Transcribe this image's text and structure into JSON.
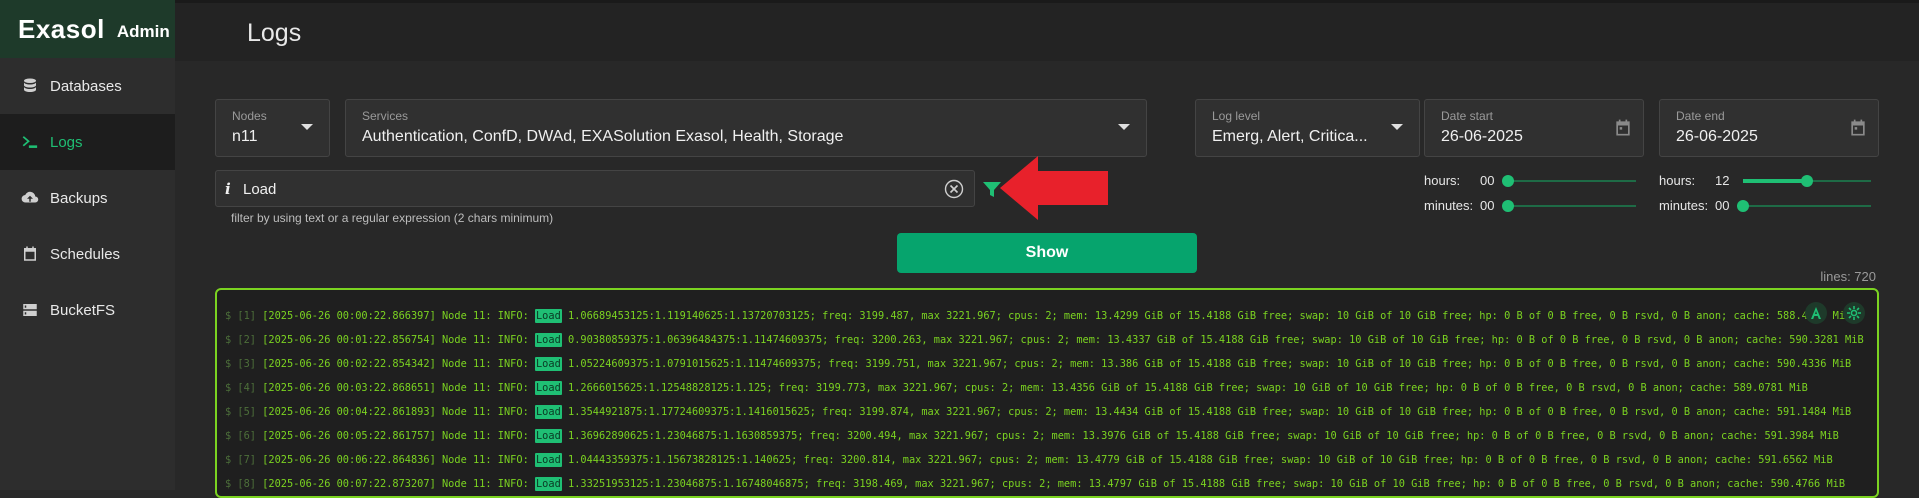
{
  "brand": {
    "logo": "Exasol",
    "sub": "Admin"
  },
  "nav": [
    {
      "label": "Databases",
      "icon": "database-icon"
    },
    {
      "label": "Logs",
      "icon": "terminal-icon"
    },
    {
      "label": "Backups",
      "icon": "cloud-upload-icon"
    },
    {
      "label": "Schedules",
      "icon": "calendar-icon"
    },
    {
      "label": "BucketFS",
      "icon": "storage-icon"
    }
  ],
  "active_nav": "Logs",
  "page": {
    "title": "Logs"
  },
  "filters": {
    "nodes": {
      "label": "Nodes",
      "value": "n11"
    },
    "services": {
      "label": "Services",
      "value": "Authentication, ConfD, DWAd, EXASolution Exasol, Health, Storage"
    },
    "log_level": {
      "label": "Log level",
      "value": "Emerg, Alert, Critica..."
    },
    "date_start": {
      "label": "Date start",
      "value": "26-06-2025"
    },
    "date_end": {
      "label": "Date end",
      "value": "26-06-2025"
    }
  },
  "text_filter": {
    "info": "i",
    "value": "Load",
    "hint": "filter by using text or a regular expression (2 chars minimum)"
  },
  "time_start": {
    "hours_label": "hours:",
    "hours_value": "00",
    "hours_fraction": 0.0,
    "minutes_label": "minutes:",
    "minutes_value": "00",
    "minutes_fraction": 0.0
  },
  "time_end": {
    "hours_label": "hours:",
    "hours_value": "12",
    "hours_fraction": 0.5,
    "minutes_label": "minutes:",
    "minutes_value": "00",
    "minutes_fraction": 0.0
  },
  "show_button": "Show",
  "lines": "lines: 720",
  "colors": {
    "accent": "#1fbf74",
    "log_text": "#7bd321",
    "arrow": "#e8212b"
  },
  "log_prefix": "$ ",
  "highlight": "Load",
  "log_lines": [
    {
      "n": "[1]",
      "ts": "[2025-06-26 00:00:22.866397] Node 11: INFO: ",
      "rest": " 1.06689453125:1.119140625:1.13720703125; freq: 3199.487, max 3221.967; cpus: 2; mem: 13.4299 GiB of 15.4188 GiB free; swap: 10 GiB of 10 GiB free; hp: 0 B of 0 B free, 0 B rsvd, 0 B anon; cache: 588.4414 MiB"
    },
    {
      "n": "[2]",
      "ts": "[2025-06-26 00:01:22.856754] Node 11: INFO: ",
      "rest": " 0.90380859375:1.06396484375:1.11474609375; freq: 3200.263, max 3221.967; cpus: 2; mem: 13.4337 GiB of 15.4188 GiB free; swap: 10 GiB of 10 GiB free; hp: 0 B of 0 B free, 0 B rsvd, 0 B anon; cache: 590.3281 MiB"
    },
    {
      "n": "[3]",
      "ts": "[2025-06-26 00:02:22.854342] Node 11: INFO: ",
      "rest": " 1.05224609375:1.0791015625:1.11474609375; freq: 3199.751, max 3221.967; cpus: 2; mem: 13.386 GiB of 15.4188 GiB free; swap: 10 GiB of 10 GiB free; hp: 0 B of 0 B free, 0 B rsvd, 0 B anon; cache: 590.4336 MiB"
    },
    {
      "n": "[4]",
      "ts": "[2025-06-26 00:03:22.868651] Node 11: INFO: ",
      "rest": " 1.2666015625:1.12548828125:1.125; freq: 3199.773, max 3221.967; cpus: 2; mem: 13.4356 GiB of 15.4188 GiB free; swap: 10 GiB of 10 GiB free; hp: 0 B of 0 B free, 0 B rsvd, 0 B anon; cache: 589.0781 MiB"
    },
    {
      "n": "[5]",
      "ts": "[2025-06-26 00:04:22.861893] Node 11: INFO: ",
      "rest": " 1.3544921875:1.17724609375:1.1416015625; freq: 3199.874, max 3221.967; cpus: 2; mem: 13.4434 GiB of 15.4188 GiB free; swap: 10 GiB of 10 GiB free; hp: 0 B of 0 B free, 0 B rsvd, 0 B anon; cache: 591.1484 MiB"
    },
    {
      "n": "[6]",
      "ts": "[2025-06-26 00:05:22.861757] Node 11: INFO: ",
      "rest": " 1.36962890625:1.23046875:1.1630859375; freq: 3200.494, max 3221.967; cpus: 2; mem: 13.3976 GiB of 15.4188 GiB free; swap: 10 GiB of 10 GiB free; hp: 0 B of 0 B free, 0 B rsvd, 0 B anon; cache: 591.3984 MiB"
    },
    {
      "n": "[7]",
      "ts": "[2025-06-26 00:06:22.864836] Node 11: INFO: ",
      "rest": " 1.04443359375:1.15673828125:1.140625; freq: 3200.814, max 3221.967; cpus: 2; mem: 13.4779 GiB of 15.4188 GiB free; swap: 10 GiB of 10 GiB free; hp: 0 B of 0 B free, 0 B rsvd, 0 B anon; cache: 591.6562 MiB"
    },
    {
      "n": "[8]",
      "ts": "[2025-06-26 00:07:22.873207] Node 11: INFO: ",
      "rest": " 1.33251953125:1.23046875:1.16748046875; freq: 3198.469, max 3221.967; cpus: 2; mem: 13.4797 GiB of 15.4188 GiB free; swap: 10 GiB of 10 GiB free; hp: 0 B of 0 B free, 0 B rsvd, 0 B anon; cache: 590.4766 MiB"
    }
  ]
}
